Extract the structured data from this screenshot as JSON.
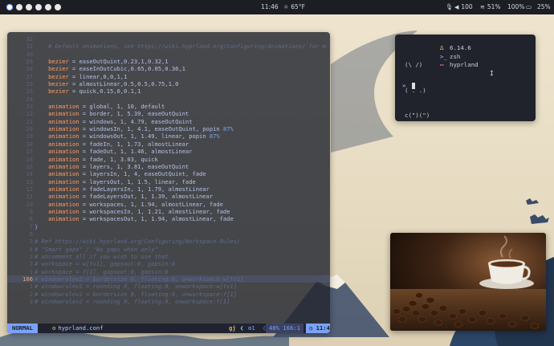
{
  "topbar": {
    "workspaces": [
      true,
      false,
      false,
      false,
      false,
      false
    ],
    "clock": "11:46",
    "weather": "65°F",
    "volume": "100",
    "network": "51%",
    "battery": "100%",
    "brightness": "25%",
    "icons": {
      "weather": "sun-icon",
      "mic": "microphone-icon",
      "volume": "speaker-icon",
      "network": "wifi-icon",
      "battery": "battery-icon",
      "brightness": "brightness-icon"
    }
  },
  "editor": {
    "lines": [
      {
        "ln": "32",
        "parts": []
      },
      {
        "ln": "31",
        "parts": [
          {
            "t": "    # Default animations, see https://wiki.hyprland.org/Configuring/Animations/ for m",
            "c": "cm"
          }
        ]
      },
      {
        "ln": "30",
        "parts": []
      },
      {
        "ln": "29",
        "parts": [
          {
            "t": "    bezier",
            "c": "kw"
          },
          {
            "t": " = easeOutQuint,0.23,1,0.32,1",
            "c": "val"
          }
        ]
      },
      {
        "ln": "28",
        "parts": [
          {
            "t": "    bezier",
            "c": "kw"
          },
          {
            "t": " = easeInOutCubic,0.65,0.05,0.36,1",
            "c": "val"
          }
        ]
      },
      {
        "ln": "27",
        "parts": [
          {
            "t": "    bezier",
            "c": "kw"
          },
          {
            "t": " = linear,0,0,1,1",
            "c": "val"
          }
        ]
      },
      {
        "ln": "26",
        "parts": [
          {
            "t": "    bezier",
            "c": "kw"
          },
          {
            "t": " = almostLinear,0.5,0.5,0.75,1.0",
            "c": "val"
          }
        ]
      },
      {
        "ln": "25",
        "parts": [
          {
            "t": "    bezier",
            "c": "kw"
          },
          {
            "t": " = quick,0.15,0,0.1,1",
            "c": "val"
          }
        ]
      },
      {
        "ln": "24",
        "parts": []
      },
      {
        "ln": "23",
        "parts": [
          {
            "t": "    animation",
            "c": "kw"
          },
          {
            "t": " = global, 1, 10, default",
            "c": "val"
          }
        ]
      },
      {
        "ln": "22",
        "parts": [
          {
            "t": "    animation",
            "c": "kw"
          },
          {
            "t": " = border, 1, 5.39, easeOutQuint",
            "c": "val"
          }
        ]
      },
      {
        "ln": "21",
        "parts": [
          {
            "t": "    animation",
            "c": "kw"
          },
          {
            "t": " = windows, 1, 4.79, easeOutQuint",
            "c": "val"
          }
        ]
      },
      {
        "ln": "20",
        "parts": [
          {
            "t": "    animation",
            "c": "kw"
          },
          {
            "t": " = windowsIn, 1, 4.1, easeOutQuint, popin ",
            "c": "val"
          },
          {
            "t": "87%",
            "c": "pl"
          }
        ]
      },
      {
        "ln": "19",
        "parts": [
          {
            "t": "    animation",
            "c": "kw"
          },
          {
            "t": " = windowsOut, 1, 1.49, linear, popin ",
            "c": "val"
          },
          {
            "t": "87%",
            "c": "pl"
          }
        ]
      },
      {
        "ln": "18",
        "parts": [
          {
            "t": "    animation",
            "c": "kw"
          },
          {
            "t": " = fadeIn, 1, 1.73, almostLinear",
            "c": "val"
          }
        ]
      },
      {
        "ln": "17",
        "parts": [
          {
            "t": "    animation",
            "c": "kw"
          },
          {
            "t": " = fadeOut, 1, 1.46, almostLinear",
            "c": "val"
          }
        ]
      },
      {
        "ln": "16",
        "parts": [
          {
            "t": "    animation",
            "c": "kw"
          },
          {
            "t": " = fade, 1, 3.03, quick",
            "c": "val"
          }
        ]
      },
      {
        "ln": "15",
        "parts": [
          {
            "t": "    animation",
            "c": "kw"
          },
          {
            "t": " = layers, 1, 3.81, easeOutQuint",
            "c": "val"
          }
        ]
      },
      {
        "ln": "14",
        "parts": [
          {
            "t": "    animation",
            "c": "kw"
          },
          {
            "t": " = layersIn, 1, 4, easeOutQuint, fade",
            "c": "val"
          }
        ]
      },
      {
        "ln": "13",
        "parts": [
          {
            "t": "    animation",
            "c": "kw"
          },
          {
            "t": " = layersOut, 1, 1.5, linear, fade",
            "c": "val"
          }
        ]
      },
      {
        "ln": "12",
        "parts": [
          {
            "t": "    animation",
            "c": "kw"
          },
          {
            "t": " = fadeLayersIn, 1, 1.79, almostLinear",
            "c": "val"
          }
        ]
      },
      {
        "ln": "11",
        "parts": [
          {
            "t": "    animation",
            "c": "kw"
          },
          {
            "t": " = fadeLayersOut, 1, 1.39, almostLinear",
            "c": "val"
          }
        ]
      },
      {
        "ln": "10",
        "parts": [
          {
            "t": "    animation",
            "c": "kw"
          },
          {
            "t": " = workspaces, 1, 1.94, almostLinear, fade",
            "c": "val"
          }
        ]
      },
      {
        "ln": "9",
        "parts": [
          {
            "t": "    animation",
            "c": "kw"
          },
          {
            "t": " = workspacesIn, 1, 1.21, almostLinear, fade",
            "c": "val"
          }
        ]
      },
      {
        "ln": "8",
        "parts": [
          {
            "t": "    animation",
            "c": "kw"
          },
          {
            "t": " = workspacesOut, 1, 1.94, almostLinear, fade",
            "c": "val"
          }
        ]
      },
      {
        "ln": "7",
        "parts": [
          {
            "t": "}",
            "c": "pl"
          }
        ]
      },
      {
        "ln": "6",
        "parts": []
      },
      {
        "ln": "5",
        "parts": [
          {
            "t": "# Ref https://wiki.hyprland.org/Configuring/Workspace-Rules/",
            "c": "cm"
          }
        ]
      },
      {
        "ln": "4",
        "parts": [
          {
            "t": "# \"Smart gaps\" / \"No gaps when only\"",
            "c": "cm"
          }
        ]
      },
      {
        "ln": "3",
        "parts": [
          {
            "t": "# uncomment all if you wish to use that.",
            "c": "cm"
          }
        ]
      },
      {
        "ln": "2",
        "parts": [
          {
            "t": "# workspace = w[tv1], gapsout:0, gapsin:0",
            "c": "cm"
          }
        ]
      },
      {
        "ln": "1",
        "parts": [
          {
            "t": "# workspace = f[1], gapsout:0, gapsin:0",
            "c": "cm"
          }
        ]
      },
      {
        "ln": "166",
        "cur": true,
        "parts": [
          {
            "t": "# windowrulev2 = bordersize 0, floating:0, onworkspace:w[tv1]",
            "c": "cm"
          }
        ]
      },
      {
        "ln": "1",
        "parts": [
          {
            "t": "# windowrulev2 = rounding 0, floating:0, onworkspace:w[tv1]",
            "c": "cm"
          }
        ]
      },
      {
        "ln": "2",
        "parts": [
          {
            "t": "# windowrulev2 = bordersize 0, floating:0, onworkspace:f[1]",
            "c": "cm"
          }
        ]
      },
      {
        "ln": "3",
        "parts": [
          {
            "t": "# windowrulev2 = rounding 0, floating:0, onworkspace:f[1]",
            "c": "cm"
          }
        ]
      }
    ],
    "status": {
      "mode": "NORMAL",
      "file": "hyprland.conf",
      "pending": "gj",
      "lsp": "1",
      "position": "48% 166:1",
      "time": "11:46"
    }
  },
  "terminal": {
    "ascii": [
      "(\\ /)",
      "( . .)",
      "c(\")(\")"
    ],
    "info": [
      {
        "icon": "linux-icon",
        "value": "6.14.6"
      },
      {
        "icon": "shell-icon",
        "value": "zsh"
      },
      {
        "icon": "monitor-icon",
        "value": "hyprland"
      }
    ],
    "prompt": "» "
  },
  "colors": {
    "accent": "#7aa2f7",
    "keyword": "#ff9e64",
    "comment": "#5c6b8c",
    "terminal_bg": "#20232b"
  }
}
